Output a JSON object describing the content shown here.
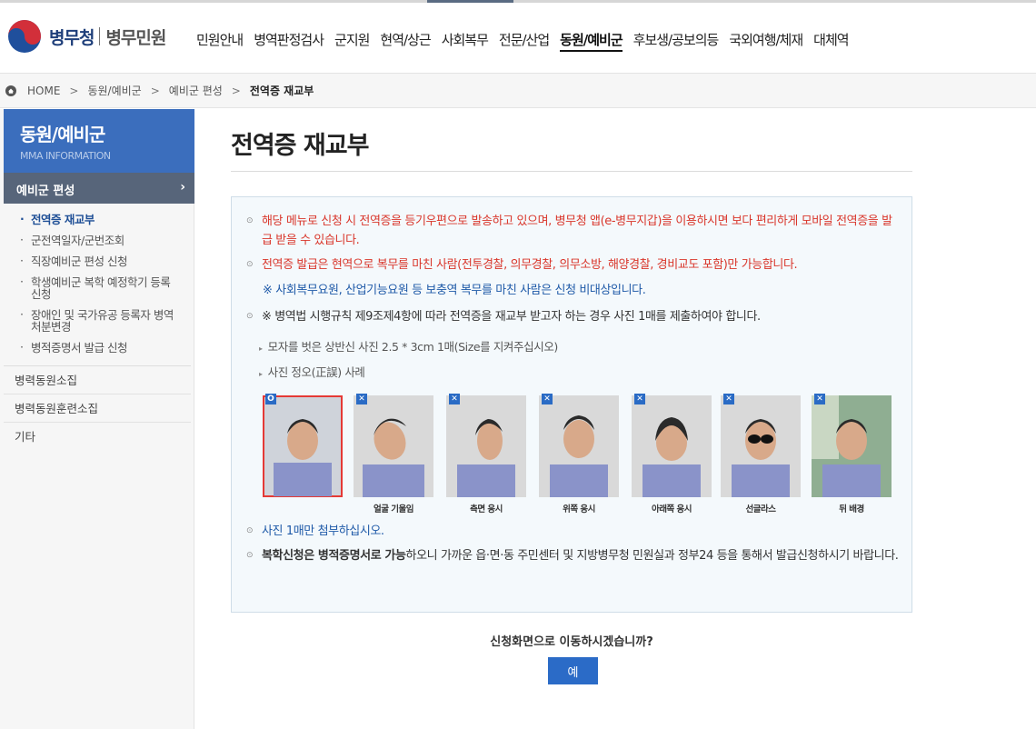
{
  "header": {
    "logo_text": "병무청",
    "logo_sub": "병무민원",
    "nav": [
      "민원안내",
      "병역판정검사",
      "군지원",
      "현역/상근",
      "사회복무",
      "전문/산업",
      "동원/예비군",
      "후보생/공보의등",
      "국외여행/체재",
      "대체역"
    ],
    "nav_active": "동원/예비군"
  },
  "breadcrumb": {
    "home": "HOME",
    "items": [
      "동원/예비군",
      "예비군 편성"
    ],
    "current": "전역증 재교부"
  },
  "lnb": {
    "title": "동원/예비군",
    "title_en": "MMA INFORMATION",
    "depth1": "예비군 편성",
    "sub_items": [
      "전역증 재교부",
      "군전역일자/군번조회",
      "직장예비군 편성 신청",
      "학생예비군 복학 예정학기 등록 신청",
      "장애인 및 국가유공 등록자 병역처분변경",
      "병적증명서 발급 신청"
    ],
    "other_items": [
      "병력동원소집",
      "병력동원훈련소집",
      "기타"
    ]
  },
  "content": {
    "title": "전역증 재교부",
    "notes": {
      "n1": "해당 메뉴로 신청 시 전역증을 등기우편으로 발송하고 있으며, 병무청 앱(e-병무지갑)을 이용하시면 보다 편리하게 모바일 전역증을 발급 받을 수 있습니다.",
      "n2": "전역증 발급은 현역으로 복무를 마친 사람(전투경찰, 의무경찰, 의무소방, 해양경찰, 경비교도 포함)만 가능합니다.",
      "n2_sub": "※ 사회복무요원, 산업기능요원 등 보충역 복무를 마친 사람은 신청 비대상입니다.",
      "n3": "※ 병역법 시행규칙 제9조제4항에 따라 전역증을 재교부 받고자 하는 경우 사진 1매를 제출하여야 합니다.",
      "sub1": "모자를 벗은 상반신 사진 2.5 * 3cm 1매(Size를 지켜주십시오)",
      "sub2": "사진 정오(正誤) 사례",
      "n4": "사진 1매만 첨부하십시오.",
      "n5_bold1": "복학신청은 병적증명서로 가능",
      "n5_rest": "하오니 가까운 읍·면·동 주민센터 및 지방병무청 민원실과 정부24 등을 통해서 발급신청하시기 바랍니다."
    },
    "photos": [
      {
        "mark": "O",
        "label": ""
      },
      {
        "mark": "✕",
        "label": "얼굴 기울임"
      },
      {
        "mark": "✕",
        "label": "측면 응시"
      },
      {
        "mark": "✕",
        "label": "위쪽 응시"
      },
      {
        "mark": "✕",
        "label": "아래쪽 응시"
      },
      {
        "mark": "✕",
        "label": "선글라스"
      },
      {
        "mark": "✕",
        "label": "뒤 배경"
      }
    ],
    "confirm_text": "신청화면으로 이동하시겠습니까?",
    "yes_label": "예"
  },
  "colors": {
    "accent": "#3b6ebd",
    "button": "#2b6bc7",
    "notice_red": "#d9362b",
    "notice_blue": "#1f5aa8"
  }
}
